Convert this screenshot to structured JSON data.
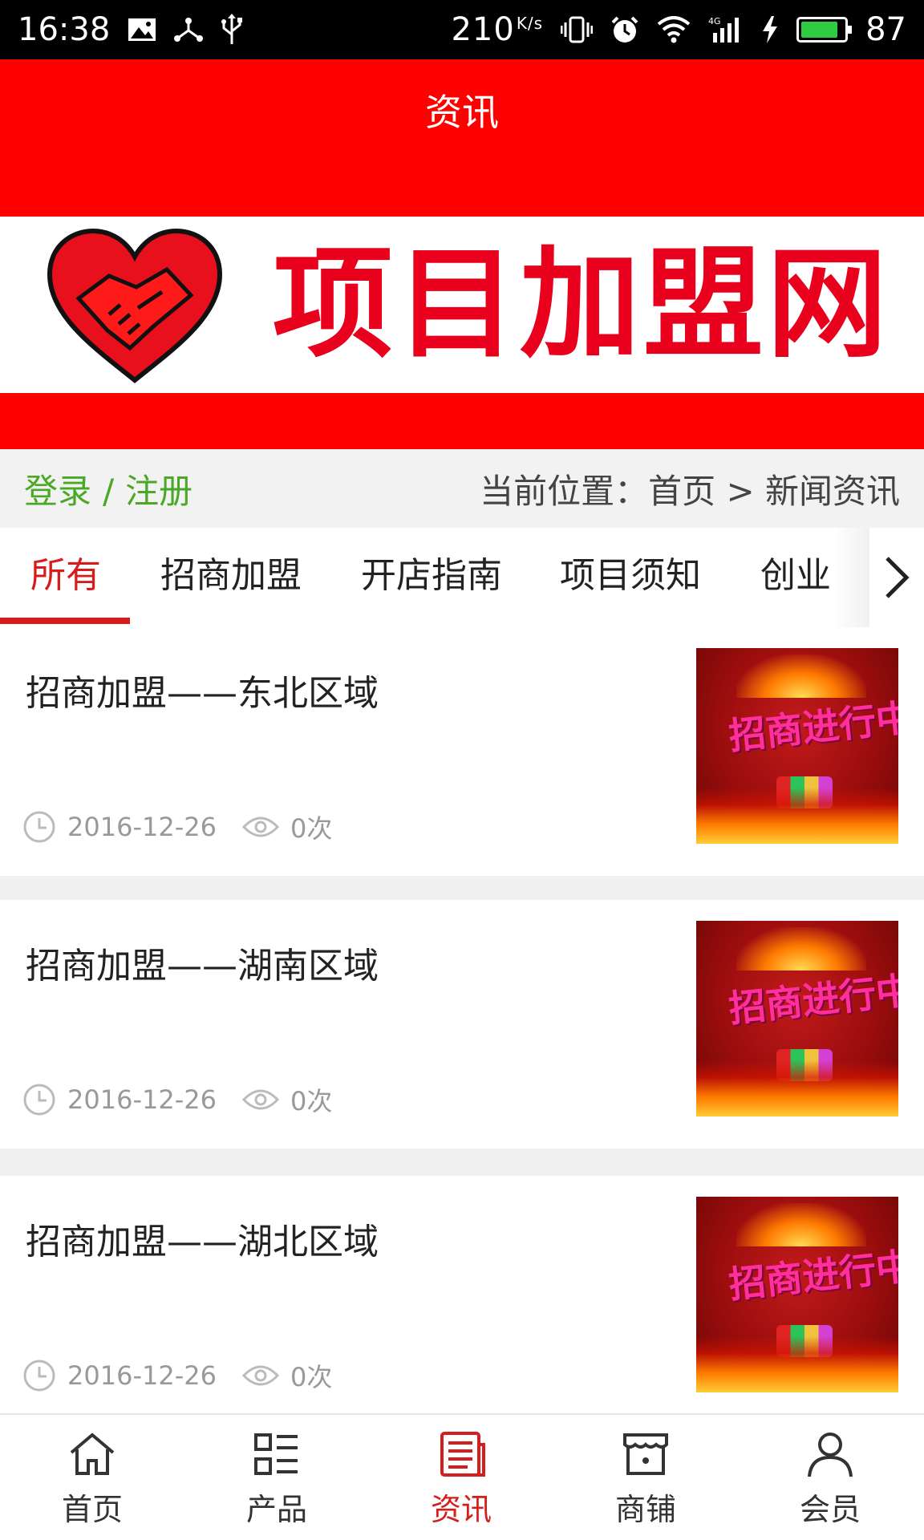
{
  "status_bar": {
    "time": "16:38",
    "net_speed": "210",
    "net_speed_unit": "K/s",
    "battery_level": "87",
    "battery_fraction": 0.87,
    "battery_color": "#2ecc40",
    "icons": [
      "image-icon",
      "share-icon",
      "usb-icon",
      "vibrate-icon",
      "alarm-icon",
      "wifi-icon",
      "signal-4g-icon",
      "charging-icon",
      "battery-icon"
    ]
  },
  "header": {
    "title": "资讯",
    "color": "#ff0000"
  },
  "banner": {
    "brand_text": "项目加盟网",
    "logo": "handshake-heart-logo",
    "brand_color": "#e8001c"
  },
  "crumb_bar": {
    "login_label": "登录",
    "separator": "/",
    "register_label": "注册",
    "location_text": "当前位置：首页 > 新闻资讯"
  },
  "tabs": {
    "items": [
      {
        "label": "所有",
        "active": true
      },
      {
        "label": "招商加盟"
      },
      {
        "label": "开店指南"
      },
      {
        "label": "项目须知"
      },
      {
        "label": "创业"
      }
    ],
    "more_icon": "chevron-right-icon",
    "accent_color": "#d61d1d"
  },
  "news": {
    "items": [
      {
        "title": "招商加盟——东北区域",
        "date": "2016-12-26",
        "views": "0次",
        "thumb_text": "招商进行中"
      },
      {
        "title": "招商加盟——湖南区域",
        "date": "2016-12-26",
        "views": "0次",
        "thumb_text": "招商进行中"
      },
      {
        "title": "招商加盟——湖北区域",
        "date": "2016-12-26",
        "views": "0次",
        "thumb_text": "招商进行中"
      }
    ]
  },
  "bottom_nav": {
    "items": [
      {
        "label": "首页",
        "icon": "home-icon"
      },
      {
        "label": "产品",
        "icon": "list-grid-icon"
      },
      {
        "label": "资讯",
        "icon": "news-icon",
        "active": true
      },
      {
        "label": "商铺",
        "icon": "shop-icon"
      },
      {
        "label": "会员",
        "icon": "user-icon"
      }
    ]
  }
}
